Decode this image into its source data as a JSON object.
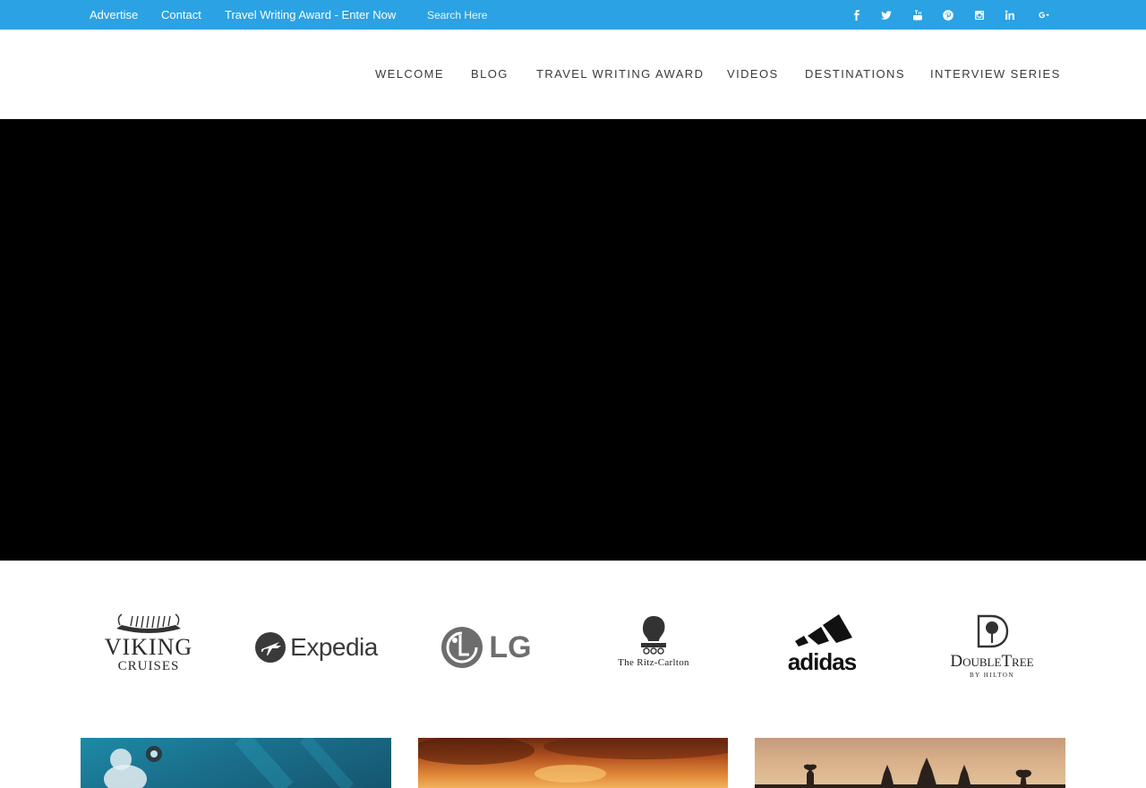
{
  "topbar": {
    "links": [
      "Advertise",
      "Contact",
      "Travel Writing Award - Enter Now"
    ],
    "search_placeholder": "Search Here",
    "social_icons": [
      "facebook-icon",
      "twitter-icon",
      "youtube-icon",
      "pinterest-icon",
      "instagram-icon",
      "linkedin-icon",
      "google-plus-icon"
    ],
    "background_color": "#2aa2e4"
  },
  "nav": {
    "items": [
      "WELCOME",
      "BLOG",
      "TRAVEL WRITING AWARD",
      "VIDEOS",
      "DESTINATIONS",
      "INTERVIEW SERIES"
    ]
  },
  "hero": {
    "background_color": "#000000"
  },
  "partners": {
    "logos": [
      {
        "name": "viking-cruises-logo",
        "text_line1": "VIKING",
        "text_line2": "CRUISES"
      },
      {
        "name": "expedia-logo",
        "text": "Expedia"
      },
      {
        "name": "lg-logo",
        "text": "LG"
      },
      {
        "name": "ritz-carlton-logo",
        "text": "The Ritz-Carlton"
      },
      {
        "name": "adidas-logo",
        "text": "adidas"
      },
      {
        "name": "doubletree-logo",
        "text_line1": "DoubleTree",
        "text_line2": "BY HILTON"
      }
    ]
  },
  "features": {
    "thumbnails": [
      "diver-underwater-image",
      "sunset-clouds-image",
      "angkor-wat-image"
    ]
  }
}
